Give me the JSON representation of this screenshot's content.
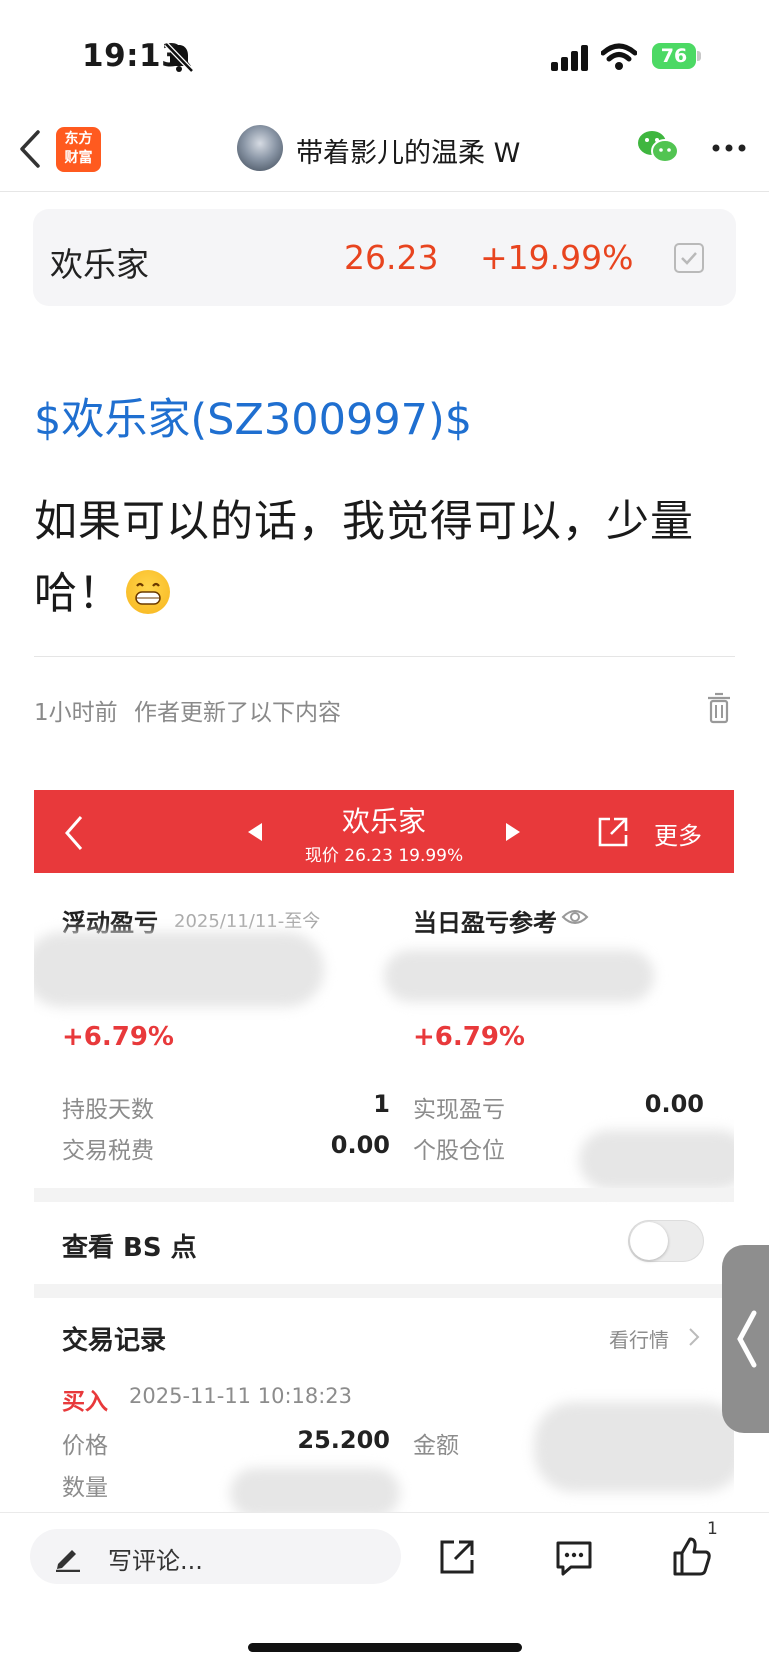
{
  "status_bar": {
    "time": "19:13",
    "battery": "76"
  },
  "nav": {
    "logo_text": "东方\n财富",
    "author": "带着影儿的温柔 W"
  },
  "stock_card": {
    "name": "欢乐家",
    "price": "26.23",
    "change": "+19.99%"
  },
  "post": {
    "stock_tag": "$欢乐家(SZ300997)$",
    "text": "如果可以的话，我觉得可以，少量哈！",
    "time": "1小时前",
    "update_note": "作者更新了以下内容"
  },
  "embedded": {
    "title": "欢乐家",
    "subtitle": "现价 26.23 19.99%",
    "more": "更多",
    "floating_pl_label": "浮动盈亏",
    "date_range": "2025/11/11-至今",
    "daily_pl_label": "当日盈亏参考",
    "floating_pct": "+6.79%",
    "daily_pct": "+6.79%",
    "hold_days_label": "持股天数",
    "hold_days": "1",
    "realized_label": "实现盈亏",
    "realized": "0.00",
    "fees_label": "交易税费",
    "fees": "0.00",
    "position_label": "个股仓位",
    "bs_label": "查看 BS 点",
    "trades_label": "交易记录",
    "market_link": "看行情",
    "buy_label": "买入",
    "buy_time": "2025-11-11 10:18:23",
    "price_label": "价格",
    "price_value": "25.200",
    "amount_label": "金额",
    "qty_label": "数量"
  },
  "bottom_bar": {
    "comment_placeholder": "写评论...",
    "like_count": "1"
  },
  "colors": {
    "accent_red": "#e8393b",
    "price_red": "#e8441f",
    "link_blue": "#1f6fd0",
    "brand_orange": "#ff5a1f"
  },
  "icons": [
    "bell-slash-icon",
    "signal-icon",
    "wifi-icon",
    "back-chevron-icon",
    "wechat-icon",
    "more-icon",
    "checkbox-icon",
    "trash-icon",
    "share-icon",
    "comment-icon",
    "like-icon",
    "pencil-icon",
    "eye-icon"
  ]
}
